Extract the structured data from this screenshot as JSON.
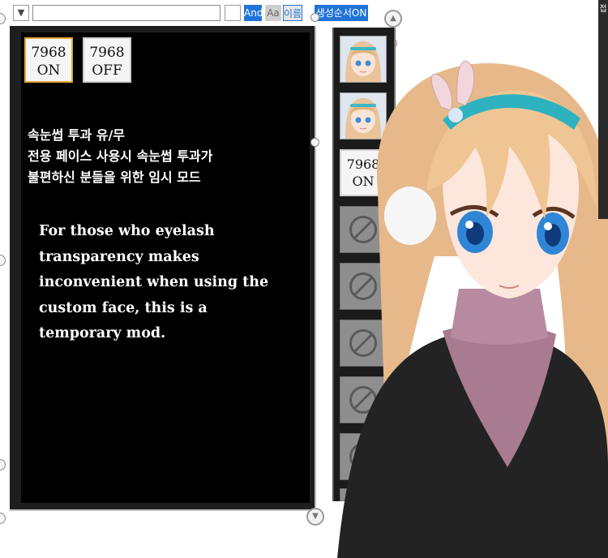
{
  "toolbar": {
    "dropdown_glyph": "▼",
    "search_value": "",
    "and_label": "And",
    "case_label": "Aa",
    "name_label": "이름",
    "sort_label": "생성순서",
    "on_label": "ON"
  },
  "options": [
    {
      "line1": "7968",
      "line2": "ON",
      "selected": true
    },
    {
      "line1": "7968",
      "line2": "OFF",
      "selected": false
    }
  ],
  "description_ko": [
    "속눈썹 투과 유/무",
    "전용 페이스 사용시 속눈썹 투과가",
    "불편하신 분들을 위한 임시 모드"
  ],
  "description_en": "For those who eyelash transparency makes inconvenient when using the custom face, this is a temporary mod.",
  "list": {
    "text_item": {
      "line1": "7968",
      "line2": "ON"
    },
    "empty_icon": "ban-icon"
  },
  "edge_label": "접",
  "colors": {
    "accent": "#1e74d8",
    "selected_border": "#e0a53a",
    "panel_bg": "#000000"
  }
}
